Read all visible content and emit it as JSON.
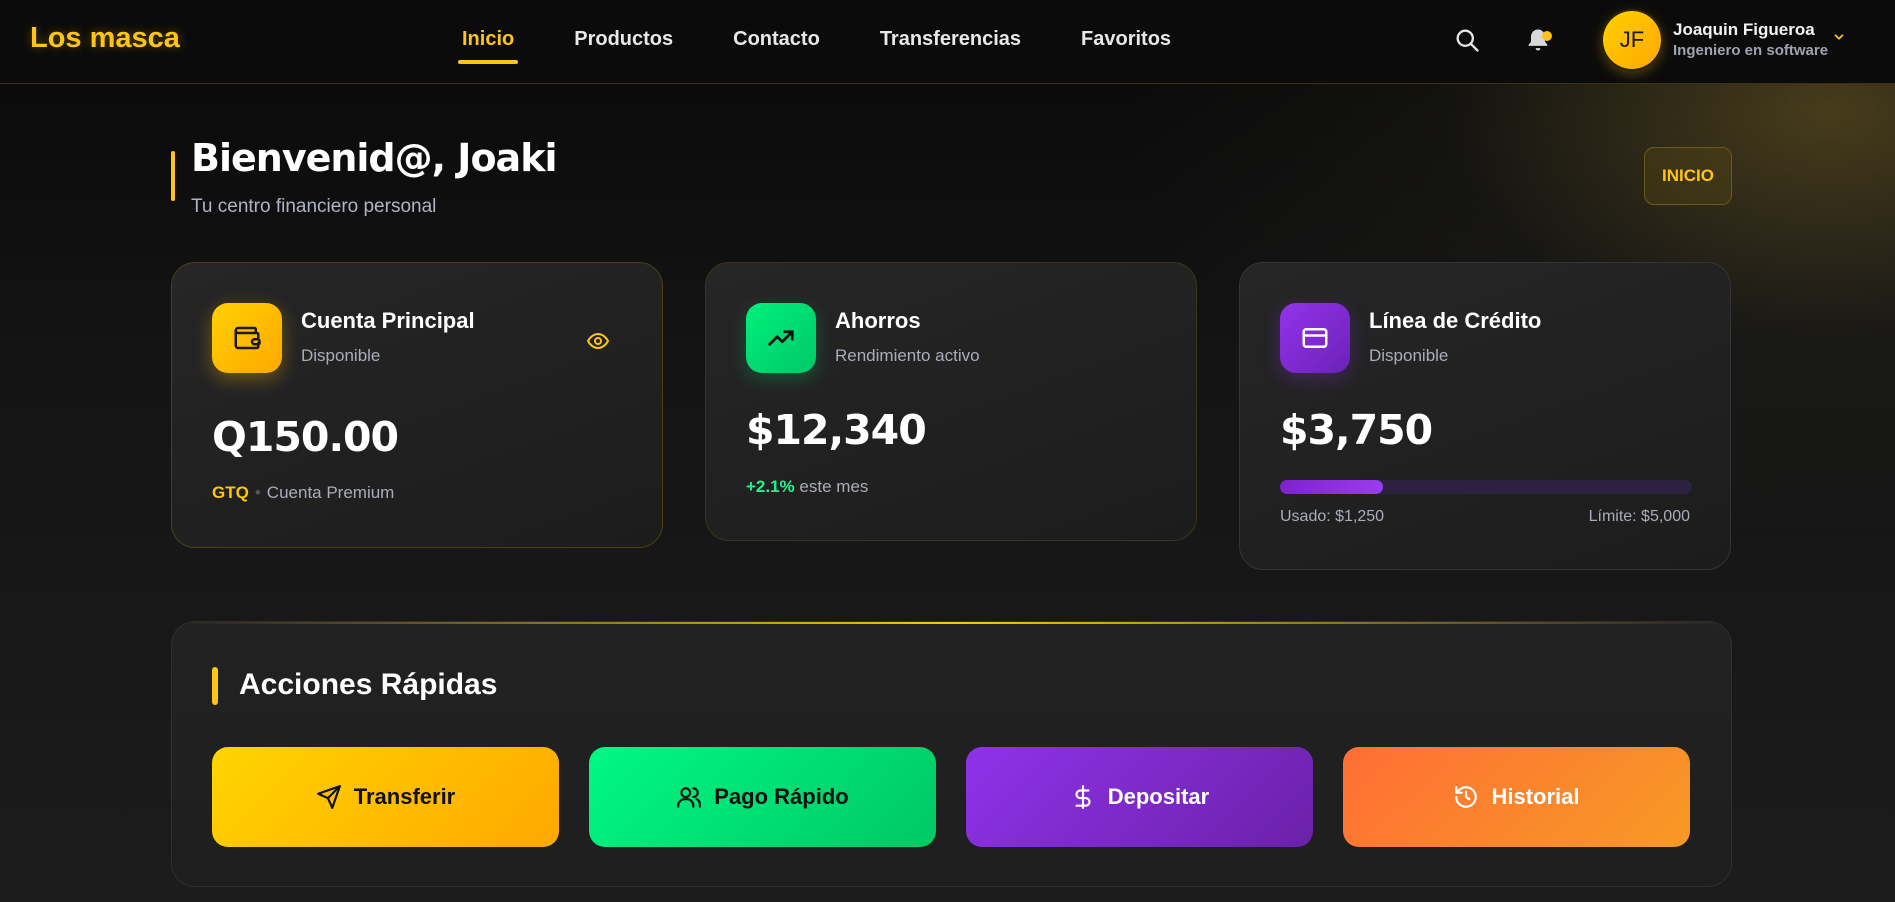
{
  "brand": "Los masca",
  "nav": {
    "links": [
      {
        "label": "Inicio",
        "active": true
      },
      {
        "label": "Productos",
        "active": false
      },
      {
        "label": "Contacto",
        "active": false
      },
      {
        "label": "Transferencias",
        "active": false
      },
      {
        "label": "Favoritos",
        "active": false
      }
    ],
    "icons": [
      "search-icon",
      "bell-icon"
    ]
  },
  "user": {
    "initials": "JF",
    "name": "Joaquin Figueroa",
    "role": "Ingeniero en software"
  },
  "welcome": {
    "title": "Bienvenid@, Joaki",
    "subtitle": "Tu centro financiero personal",
    "badge": "INICIO"
  },
  "cards": {
    "principal": {
      "title": "Cuenta Principal",
      "subtitle": "Disponible",
      "amount": "Q150.00",
      "currency": "GTQ",
      "tier": "Cuenta Premium"
    },
    "ahorros": {
      "title": "Ahorros",
      "subtitle": "Rendimiento activo",
      "amount": "$12,340",
      "growth": "+2.1%",
      "growth_suffix": "este mes"
    },
    "credito": {
      "title": "Línea de Crédito",
      "subtitle": "Disponible",
      "amount": "$3,750",
      "used_label": "Usado: $1,250",
      "limit_label": "Límite: $5,000",
      "used_fraction": 0.25
    }
  },
  "actions": {
    "title": "Acciones Rápidas",
    "buttons": [
      {
        "label": "Transferir",
        "icon": "send-icon"
      },
      {
        "label": "Pago Rápido",
        "icon": "users-icon"
      },
      {
        "label": "Depositar",
        "icon": "dollar-icon"
      },
      {
        "label": "Historial",
        "icon": "history-icon"
      }
    ]
  },
  "colors": {
    "accent": "#ffc415",
    "green": "#00e676",
    "purple": "#7e22ce",
    "orange": "#ff7a30",
    "background": "#141414"
  }
}
